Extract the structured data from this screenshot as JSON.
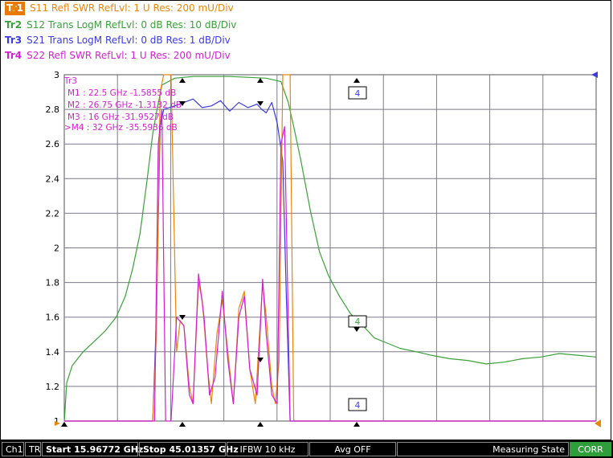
{
  "legend": [
    {
      "tag": "Tr1",
      "text": "S11 Refl SWR RefLvl: 1  U Res: 200 mU/Div",
      "color": "#e8860a",
      "active": true
    },
    {
      "tag": "Tr2",
      "text": "S12 Trans LogM RefLvl: 0  dB Res: 10  dB/Div",
      "color": "#3aa13a",
      "active": false
    },
    {
      "tag": "Tr3",
      "text": "S21 Trans LogM RefLvl: 0  dB Res: 1  dB/Div",
      "color": "#3b3be0",
      "active": false
    },
    {
      "tag": "Tr4",
      "text": "S22 Refl SWR RefLvl: 1  U Res: 200 mU/Div",
      "color": "#d21fd2",
      "active": false
    }
  ],
  "marker_table": {
    "header": "Tr3",
    "rows": [
      "M1 :  22.5 GHz  -1.5855  dB",
      "M2 :  26.75 GHz  -1.3132  dB",
      "M3 :  16 GHz  -31.9527  dB",
      ">M4 :  32 GHz  -35.5936  dB"
    ],
    "color": "#d21fd2"
  },
  "marker_boxes": [
    "4",
    "4",
    "4"
  ],
  "status": {
    "channel": "Ch1",
    "mode": "TR",
    "start": "Start 15.96772 GHz",
    "stop": "Stop 45.01357 GHz",
    "ifbw": "IFBW 10 kHz",
    "avg": "Avg OFF",
    "state": "Measuring State",
    "corr": "CORR"
  },
  "chart_data": {
    "type": "line",
    "x_range_ghz": [
      15.96772,
      45.01357
    ],
    "ylim": [
      1,
      3
    ],
    "yticks": [
      "3",
      "2.8",
      "2.6",
      "2.4",
      "2.2",
      "2",
      "1.8",
      "1.6",
      "1.4",
      "1.2",
      "1"
    ],
    "grid": true,
    "series": [
      {
        "name": "Tr1",
        "color": "#e8860a",
        "points": [
          [
            15.97,
            1.0
          ],
          [
            20.8,
            1.0
          ],
          [
            21.0,
            1.5
          ],
          [
            21.2,
            2.9
          ],
          [
            21.4,
            3.0
          ],
          [
            21.8,
            3.0
          ],
          [
            22.1,
            1.4
          ],
          [
            22.3,
            1.58
          ],
          [
            22.5,
            1.55
          ],
          [
            22.8,
            1.2
          ],
          [
            23.0,
            1.1
          ],
          [
            23.3,
            1.8
          ],
          [
            23.5,
            1.7
          ],
          [
            23.8,
            1.3
          ],
          [
            24.0,
            1.1
          ],
          [
            24.3,
            1.5
          ],
          [
            24.6,
            1.7
          ],
          [
            24.9,
            1.4
          ],
          [
            25.2,
            1.1
          ],
          [
            25.5,
            1.65
          ],
          [
            25.8,
            1.75
          ],
          [
            26.1,
            1.3
          ],
          [
            26.4,
            1.1
          ],
          [
            26.8,
            1.8
          ],
          [
            27.0,
            1.6
          ],
          [
            27.3,
            1.2
          ],
          [
            27.5,
            1.1
          ],
          [
            27.7,
            1.35
          ],
          [
            27.9,
            3.0
          ],
          [
            28.3,
            3.0
          ],
          [
            28.5,
            1.0
          ],
          [
            45.0,
            1.0
          ]
        ]
      },
      {
        "name": "Tr2",
        "color": "#3aa13a",
        "points": [
          [
            15.97,
            1.0
          ],
          [
            16.1,
            1.22
          ],
          [
            16.4,
            1.32
          ],
          [
            17.0,
            1.4
          ],
          [
            17.6,
            1.46
          ],
          [
            18.2,
            1.52
          ],
          [
            18.8,
            1.6
          ],
          [
            19.3,
            1.72
          ],
          [
            19.7,
            1.88
          ],
          [
            20.1,
            2.08
          ],
          [
            20.5,
            2.4
          ],
          [
            20.8,
            2.66
          ],
          [
            21.0,
            2.78
          ],
          [
            21.3,
            2.94
          ],
          [
            22.0,
            2.98
          ],
          [
            23.0,
            2.99
          ],
          [
            25.0,
            2.99
          ],
          [
            27.0,
            2.98
          ],
          [
            27.8,
            2.96
          ],
          [
            28.2,
            2.84
          ],
          [
            28.5,
            2.7
          ],
          [
            28.9,
            2.5
          ],
          [
            29.4,
            2.22
          ],
          [
            29.9,
            1.98
          ],
          [
            30.4,
            1.84
          ],
          [
            31.0,
            1.72
          ],
          [
            31.6,
            1.62
          ],
          [
            32.2,
            1.56
          ],
          [
            32.9,
            1.48
          ],
          [
            33.6,
            1.45
          ],
          [
            34.3,
            1.42
          ],
          [
            35.2,
            1.4
          ],
          [
            36.0,
            1.38
          ],
          [
            37.0,
            1.36
          ],
          [
            38.0,
            1.35
          ],
          [
            39.0,
            1.33
          ],
          [
            40.0,
            1.34
          ],
          [
            41.0,
            1.36
          ],
          [
            42.0,
            1.37
          ],
          [
            43.0,
            1.39
          ],
          [
            44.0,
            1.38
          ],
          [
            45.0,
            1.37
          ]
        ]
      },
      {
        "name": "Tr3",
        "color": "#3b3be0",
        "points": [
          [
            15.97,
            1.0
          ],
          [
            20.8,
            1.0
          ],
          [
            21.0,
            1.6
          ],
          [
            21.2,
            2.7
          ],
          [
            21.4,
            2.8
          ],
          [
            22.0,
            2.82
          ],
          [
            22.5,
            2.84
          ],
          [
            23.0,
            2.86
          ],
          [
            23.5,
            2.81
          ],
          [
            24.0,
            2.82
          ],
          [
            24.5,
            2.85
          ],
          [
            25.0,
            2.79
          ],
          [
            25.5,
            2.84
          ],
          [
            26.0,
            2.81
          ],
          [
            26.5,
            2.83
          ],
          [
            26.75,
            2.8
          ],
          [
            27.0,
            2.78
          ],
          [
            27.3,
            2.84
          ],
          [
            27.6,
            2.72
          ],
          [
            27.9,
            2.5
          ],
          [
            28.1,
            1.7
          ],
          [
            28.3,
            1.0
          ],
          [
            45.0,
            1.0
          ]
        ]
      },
      {
        "name": "Tr4",
        "color": "#d21fd2",
        "points": [
          [
            15.97,
            1.0
          ],
          [
            20.9,
            1.0
          ],
          [
            21.1,
            2.6
          ],
          [
            21.3,
            2.8
          ],
          [
            21.5,
            1.0
          ],
          [
            21.8,
            1.0
          ],
          [
            22.1,
            1.6
          ],
          [
            22.5,
            1.55
          ],
          [
            22.8,
            1.15
          ],
          [
            23.0,
            1.1
          ],
          [
            23.3,
            1.85
          ],
          [
            23.6,
            1.6
          ],
          [
            23.9,
            1.15
          ],
          [
            24.2,
            1.25
          ],
          [
            24.6,
            1.75
          ],
          [
            24.9,
            1.35
          ],
          [
            25.2,
            1.1
          ],
          [
            25.5,
            1.6
          ],
          [
            25.8,
            1.72
          ],
          [
            26.1,
            1.3
          ],
          [
            26.5,
            1.15
          ],
          [
            26.8,
            1.82
          ],
          [
            27.0,
            1.5
          ],
          [
            27.3,
            1.15
          ],
          [
            27.6,
            1.1
          ],
          [
            27.8,
            2.6
          ],
          [
            28.0,
            2.7
          ],
          [
            28.3,
            1.0
          ],
          [
            45.0,
            1.0
          ]
        ]
      }
    ]
  }
}
